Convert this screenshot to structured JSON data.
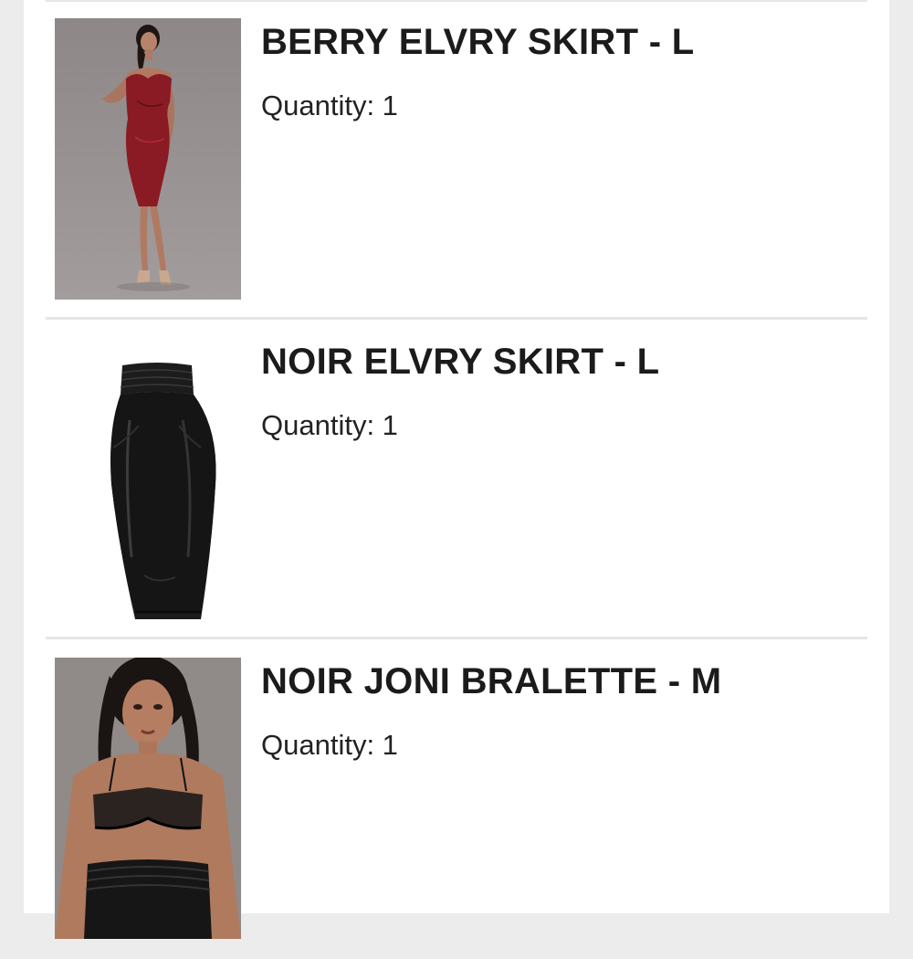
{
  "order_items": [
    {
      "name": "BERRY ELVRY SKIRT - L",
      "quantity_label": "Quantity: 1",
      "image_icon": "model-red-leather-outfit-photo",
      "image_bg": "#8a8585",
      "garment_color": "#8a1a24"
    },
    {
      "name": "NOIR ELVRY SKIRT - L",
      "quantity_label": "Quantity: 1",
      "image_icon": "black-leather-pencil-skirt-photo",
      "image_bg": "#ffffff",
      "garment_color": "#1a1a1a"
    },
    {
      "name": "NOIR JONI BRALETTE - M",
      "quantity_label": "Quantity: 1",
      "image_icon": "model-black-bralette-photo",
      "image_bg": "#8f8a88",
      "garment_color": "#111111"
    }
  ]
}
